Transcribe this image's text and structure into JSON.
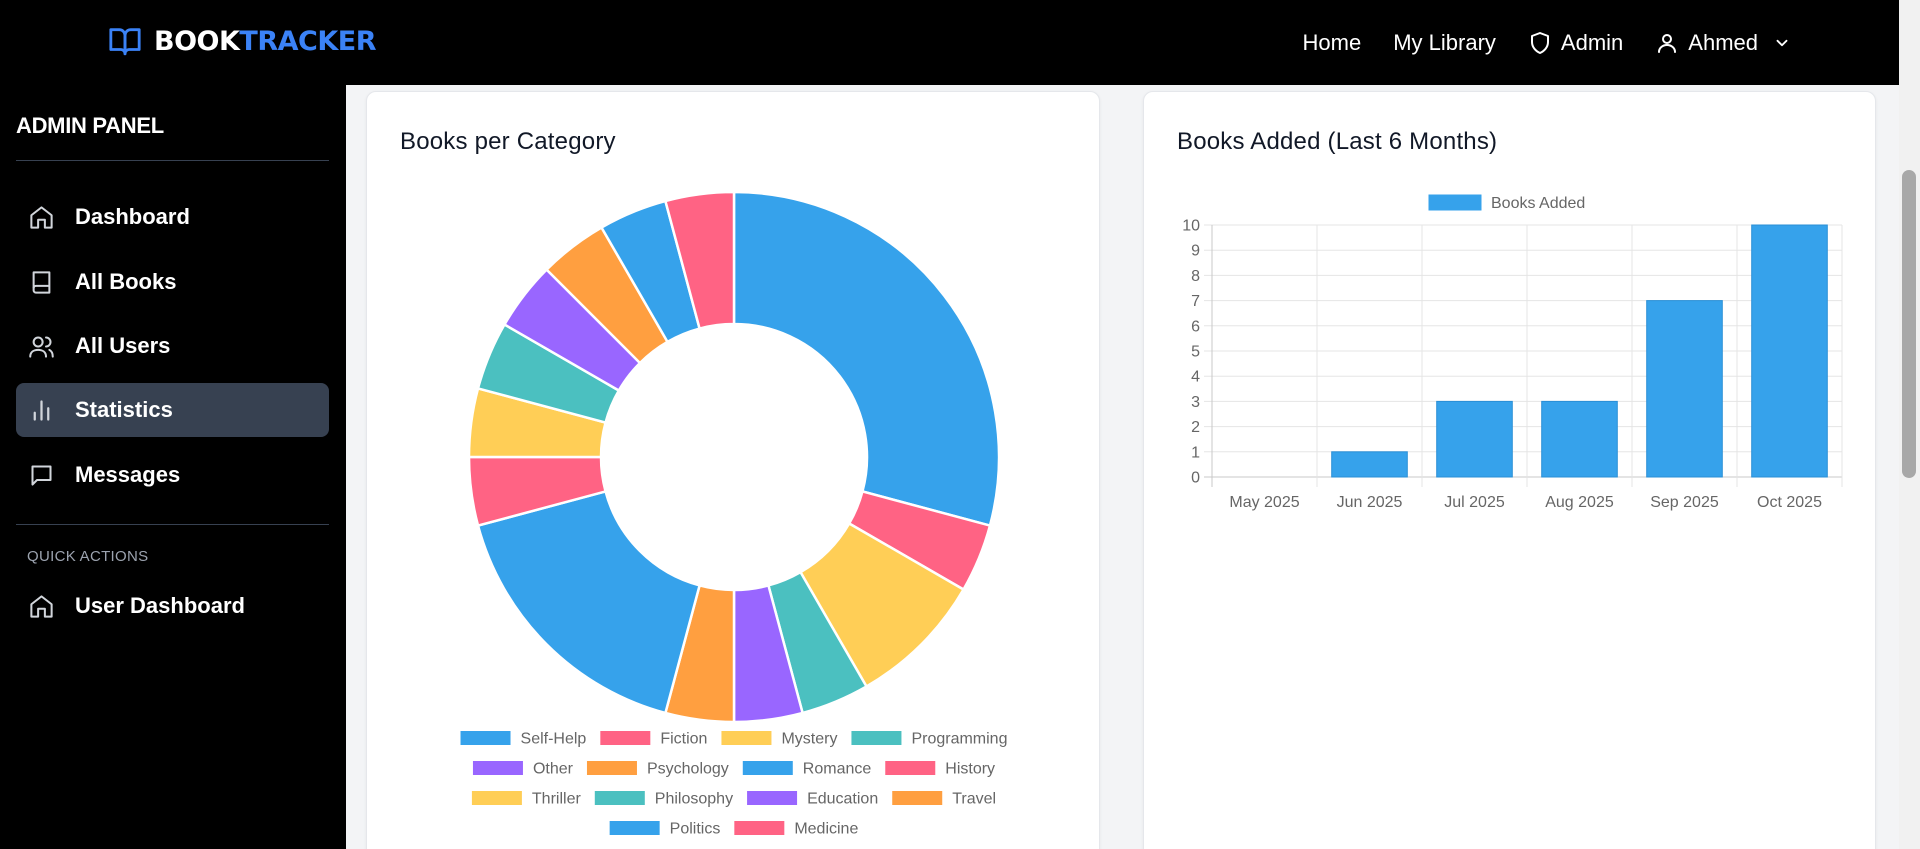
{
  "brand": {
    "part1": "BOOK",
    "part2": "TRACKER"
  },
  "nav": {
    "home": "Home",
    "library": "My Library",
    "admin": "Admin",
    "user": "Ahmed"
  },
  "sidebar": {
    "title": "ADMIN PANEL",
    "items": [
      {
        "label": "Dashboard",
        "icon": "home-icon"
      },
      {
        "label": "All Books",
        "icon": "book-icon"
      },
      {
        "label": "All Users",
        "icon": "users-icon"
      },
      {
        "label": "Statistics",
        "icon": "bar-chart-icon",
        "active": true
      },
      {
        "label": "Messages",
        "icon": "message-icon"
      }
    ],
    "quick_actions_title": "QUICK ACTIONS",
    "quick_actions": [
      {
        "label": "User Dashboard",
        "icon": "home-icon"
      }
    ]
  },
  "cards": {
    "category_title": "Books per Category",
    "monthly_title": "Books Added (Last 6 Months)"
  },
  "colors": {
    "blue": "#36A2EB",
    "pink": "#FF6384",
    "yellow": "#FFCE56",
    "teal": "#4BC0C0",
    "purple": "#9966FF",
    "orange": "#FF9F40"
  },
  "chart_data": [
    {
      "type": "doughnut",
      "title": "Books per Category",
      "labels": [
        "Self-Help",
        "Fiction",
        "Mystery",
        "Programming",
        "Other",
        "Psychology",
        "Romance",
        "History",
        "Thriller",
        "Philosophy",
        "Education",
        "Travel",
        "Politics",
        "Medicine"
      ],
      "values": [
        7,
        1,
        2,
        1,
        1,
        1,
        4,
        1,
        1,
        1,
        1,
        1,
        1,
        1
      ],
      "colors": [
        "#36A2EB",
        "#FF6384",
        "#FFCE56",
        "#4BC0C0",
        "#9966FF",
        "#FF9F40",
        "#36A2EB",
        "#FF6384",
        "#FFCE56",
        "#4BC0C0",
        "#9966FF",
        "#FF9F40",
        "#36A2EB",
        "#FF6384"
      ],
      "legend": "bottom"
    },
    {
      "type": "bar",
      "title": "Books Added (Last 6 Months)",
      "categories": [
        "May 2025",
        "Jun 2025",
        "Jul 2025",
        "Aug 2025",
        "Sep 2025",
        "Oct 2025"
      ],
      "series": [
        {
          "name": "Books Added",
          "values": [
            0,
            1,
            3,
            3,
            7,
            10
          ]
        }
      ],
      "ylim": [
        0,
        10
      ],
      "yticks": [
        0,
        1,
        2,
        3,
        4,
        5,
        6,
        7,
        8,
        9,
        10
      ],
      "grid": true,
      "legend": "top",
      "color": "#36A2EB"
    }
  ]
}
